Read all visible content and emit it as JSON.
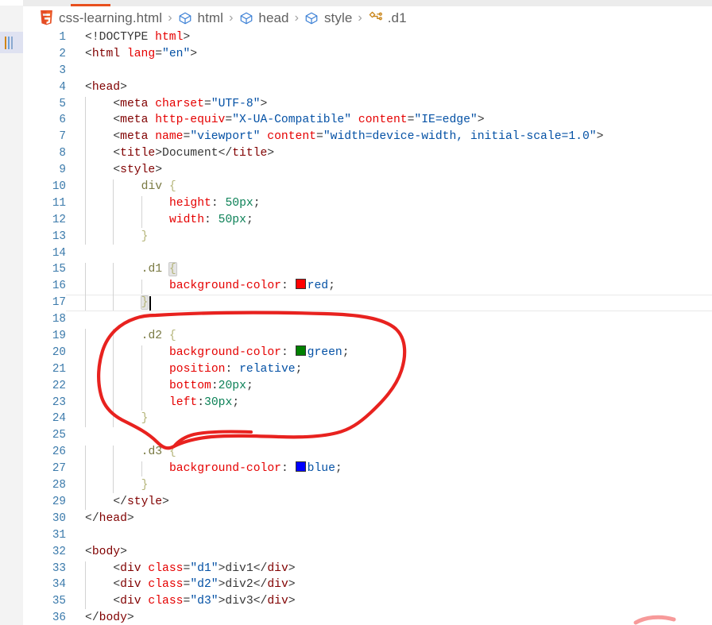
{
  "window": {
    "active_tab_indicator_color": "#e8501e",
    "strip_bg": "#ececec"
  },
  "breadcrumb": {
    "items": [
      {
        "icon": "html5-icon",
        "label": "css-learning.html"
      },
      {
        "icon": "symbol-cube-icon",
        "label": "html"
      },
      {
        "icon": "symbol-cube-icon",
        "label": "head"
      },
      {
        "icon": "symbol-cube-icon",
        "label": "style"
      },
      {
        "icon": "symbol-css-class-icon",
        "label": ".d1"
      }
    ],
    "separator": "›"
  },
  "editor": {
    "language": "html",
    "cursor_line": 17,
    "current_line": 17,
    "lines": [
      {
        "n": "1",
        "indent": 0,
        "tokens": [
          {
            "c": "t-punc",
            "t": "<!DOCTYPE "
          },
          {
            "c": "t-attr",
            "t": "html"
          },
          {
            "c": "t-punc",
            "t": ">"
          }
        ]
      },
      {
        "n": "2",
        "indent": 0,
        "tokens": [
          {
            "c": "t-punc",
            "t": "<"
          },
          {
            "c": "t-tag",
            "t": "html"
          },
          {
            "c": "t-txt",
            "t": " "
          },
          {
            "c": "t-attr",
            "t": "lang"
          },
          {
            "c": "t-punc",
            "t": "="
          },
          {
            "c": "t-str",
            "t": "\"en\""
          },
          {
            "c": "t-punc",
            "t": ">"
          }
        ]
      },
      {
        "n": "3",
        "indent": 0,
        "tokens": []
      },
      {
        "n": "4",
        "indent": 0,
        "tokens": [
          {
            "c": "t-punc",
            "t": "<"
          },
          {
            "c": "t-tag",
            "t": "head"
          },
          {
            "c": "t-punc",
            "t": ">"
          }
        ]
      },
      {
        "n": "5",
        "indent": 1,
        "tokens": [
          {
            "c": "t-punc",
            "t": "<"
          },
          {
            "c": "t-tag",
            "t": "meta"
          },
          {
            "c": "t-txt",
            "t": " "
          },
          {
            "c": "t-attr",
            "t": "charset"
          },
          {
            "c": "t-punc",
            "t": "="
          },
          {
            "c": "t-str",
            "t": "\"UTF-8\""
          },
          {
            "c": "t-punc",
            "t": ">"
          }
        ]
      },
      {
        "n": "6",
        "indent": 1,
        "tokens": [
          {
            "c": "t-punc",
            "t": "<"
          },
          {
            "c": "t-tag",
            "t": "meta"
          },
          {
            "c": "t-txt",
            "t": " "
          },
          {
            "c": "t-attr",
            "t": "http-equiv"
          },
          {
            "c": "t-punc",
            "t": "="
          },
          {
            "c": "t-str",
            "t": "\"X-UA-Compatible\""
          },
          {
            "c": "t-txt",
            "t": " "
          },
          {
            "c": "t-attr",
            "t": "content"
          },
          {
            "c": "t-punc",
            "t": "="
          },
          {
            "c": "t-str",
            "t": "\"IE=edge\""
          },
          {
            "c": "t-punc",
            "t": ">"
          }
        ]
      },
      {
        "n": "7",
        "indent": 1,
        "tokens": [
          {
            "c": "t-punc",
            "t": "<"
          },
          {
            "c": "t-tag",
            "t": "meta"
          },
          {
            "c": "t-txt",
            "t": " "
          },
          {
            "c": "t-attr",
            "t": "name"
          },
          {
            "c": "t-punc",
            "t": "="
          },
          {
            "c": "t-str",
            "t": "\"viewport\""
          },
          {
            "c": "t-txt",
            "t": " "
          },
          {
            "c": "t-attr",
            "t": "content"
          },
          {
            "c": "t-punc",
            "t": "="
          },
          {
            "c": "t-str",
            "t": "\"width=device-width, initial-scale=1.0\""
          },
          {
            "c": "t-punc",
            "t": ">"
          }
        ]
      },
      {
        "n": "8",
        "indent": 1,
        "tokens": [
          {
            "c": "t-punc",
            "t": "<"
          },
          {
            "c": "t-tag",
            "t": "title"
          },
          {
            "c": "t-punc",
            "t": ">"
          },
          {
            "c": "t-txt",
            "t": "Document"
          },
          {
            "c": "t-punc",
            "t": "</"
          },
          {
            "c": "t-tag",
            "t": "title"
          },
          {
            "c": "t-punc",
            "t": ">"
          }
        ]
      },
      {
        "n": "9",
        "indent": 1,
        "tokens": [
          {
            "c": "t-punc",
            "t": "<"
          },
          {
            "c": "t-tag",
            "t": "style"
          },
          {
            "c": "t-punc",
            "t": ">"
          }
        ]
      },
      {
        "n": "10",
        "indent": 2,
        "tokens": [
          {
            "c": "t-sel",
            "t": "div"
          },
          {
            "c": "t-txt",
            "t": " "
          },
          {
            "c": "t-brace",
            "t": "{"
          }
        ]
      },
      {
        "n": "11",
        "indent": 3,
        "tokens": [
          {
            "c": "t-prop",
            "t": "height"
          },
          {
            "c": "t-semi",
            "t": ": "
          },
          {
            "c": "t-num",
            "t": "50px"
          },
          {
            "c": "t-semi",
            "t": ";"
          }
        ]
      },
      {
        "n": "12",
        "indent": 3,
        "tokens": [
          {
            "c": "t-prop",
            "t": "width"
          },
          {
            "c": "t-semi",
            "t": ": "
          },
          {
            "c": "t-num",
            "t": "50px"
          },
          {
            "c": "t-semi",
            "t": ";"
          }
        ]
      },
      {
        "n": "13",
        "indent": 2,
        "tokens": [
          {
            "c": "t-brace",
            "t": "}"
          }
        ]
      },
      {
        "n": "14",
        "indent": 0,
        "tokens": []
      },
      {
        "n": "15",
        "indent": 2,
        "tokens": [
          {
            "c": "t-sel",
            "t": ".d1"
          },
          {
            "c": "t-txt",
            "t": " "
          },
          {
            "c": "t-brace brace-match",
            "t": "{"
          }
        ]
      },
      {
        "n": "16",
        "indent": 3,
        "tokens": [
          {
            "c": "t-prop",
            "t": "background-color"
          },
          {
            "c": "t-semi",
            "t": ": "
          },
          {
            "c": "swatch",
            "t": "",
            "swatch": "#ff0000"
          },
          {
            "c": "t-val",
            "t": "red"
          },
          {
            "c": "t-semi",
            "t": ";"
          }
        ]
      },
      {
        "n": "17",
        "indent": 2,
        "tokens": [
          {
            "c": "t-brace brace-match",
            "t": "}"
          }
        ]
      },
      {
        "n": "18",
        "indent": 0,
        "tokens": []
      },
      {
        "n": "19",
        "indent": 2,
        "tokens": [
          {
            "c": "t-sel",
            "t": ".d2"
          },
          {
            "c": "t-txt",
            "t": " "
          },
          {
            "c": "t-brace",
            "t": "{"
          }
        ]
      },
      {
        "n": "20",
        "indent": 3,
        "tokens": [
          {
            "c": "t-prop",
            "t": "background-color"
          },
          {
            "c": "t-semi",
            "t": ": "
          },
          {
            "c": "swatch",
            "t": "",
            "swatch": "#008000"
          },
          {
            "c": "t-val",
            "t": "green"
          },
          {
            "c": "t-semi",
            "t": ";"
          }
        ]
      },
      {
        "n": "21",
        "indent": 3,
        "tokens": [
          {
            "c": "t-prop",
            "t": "position"
          },
          {
            "c": "t-semi",
            "t": ": "
          },
          {
            "c": "t-val",
            "t": "relative"
          },
          {
            "c": "t-semi",
            "t": ";"
          }
        ]
      },
      {
        "n": "22",
        "indent": 3,
        "tokens": [
          {
            "c": "t-prop",
            "t": "bottom"
          },
          {
            "c": "t-semi",
            "t": ":"
          },
          {
            "c": "t-num",
            "t": "20px"
          },
          {
            "c": "t-semi",
            "t": ";"
          }
        ]
      },
      {
        "n": "23",
        "indent": 3,
        "tokens": [
          {
            "c": "t-prop",
            "t": "left"
          },
          {
            "c": "t-semi",
            "t": ":"
          },
          {
            "c": "t-num",
            "t": "30px"
          },
          {
            "c": "t-semi",
            "t": ";"
          }
        ]
      },
      {
        "n": "24",
        "indent": 2,
        "tokens": [
          {
            "c": "t-brace",
            "t": "}"
          }
        ]
      },
      {
        "n": "25",
        "indent": 0,
        "tokens": []
      },
      {
        "n": "26",
        "indent": 2,
        "tokens": [
          {
            "c": "t-sel",
            "t": ".d3"
          },
          {
            "c": "t-txt",
            "t": " "
          },
          {
            "c": "t-brace",
            "t": "{"
          }
        ]
      },
      {
        "n": "27",
        "indent": 3,
        "tokens": [
          {
            "c": "t-prop",
            "t": "background-color"
          },
          {
            "c": "t-semi",
            "t": ": "
          },
          {
            "c": "swatch",
            "t": "",
            "swatch": "#0000ff"
          },
          {
            "c": "t-val",
            "t": "blue"
          },
          {
            "c": "t-semi",
            "t": ";"
          }
        ]
      },
      {
        "n": "28",
        "indent": 2,
        "tokens": [
          {
            "c": "t-brace",
            "t": "}"
          }
        ]
      },
      {
        "n": "29",
        "indent": 1,
        "tokens": [
          {
            "c": "t-punc",
            "t": "</"
          },
          {
            "c": "t-tag",
            "t": "style"
          },
          {
            "c": "t-punc",
            "t": ">"
          }
        ]
      },
      {
        "n": "30",
        "indent": 0,
        "tokens": [
          {
            "c": "t-punc",
            "t": "</"
          },
          {
            "c": "t-tag",
            "t": "head"
          },
          {
            "c": "t-punc",
            "t": ">"
          }
        ]
      },
      {
        "n": "31",
        "indent": 0,
        "tokens": []
      },
      {
        "n": "32",
        "indent": 0,
        "tokens": [
          {
            "c": "t-punc",
            "t": "<"
          },
          {
            "c": "t-tag",
            "t": "body"
          },
          {
            "c": "t-punc",
            "t": ">"
          }
        ]
      },
      {
        "n": "33",
        "indent": 1,
        "tokens": [
          {
            "c": "t-punc",
            "t": "<"
          },
          {
            "c": "t-tag",
            "t": "div"
          },
          {
            "c": "t-txt",
            "t": " "
          },
          {
            "c": "t-attr",
            "t": "class"
          },
          {
            "c": "t-punc",
            "t": "="
          },
          {
            "c": "t-str",
            "t": "\"d1\""
          },
          {
            "c": "t-punc",
            "t": ">"
          },
          {
            "c": "t-txt",
            "t": "div1"
          },
          {
            "c": "t-punc",
            "t": "</"
          },
          {
            "c": "t-tag",
            "t": "div"
          },
          {
            "c": "t-punc",
            "t": ">"
          }
        ]
      },
      {
        "n": "34",
        "indent": 1,
        "tokens": [
          {
            "c": "t-punc",
            "t": "<"
          },
          {
            "c": "t-tag",
            "t": "div"
          },
          {
            "c": "t-txt",
            "t": " "
          },
          {
            "c": "t-attr",
            "t": "class"
          },
          {
            "c": "t-punc",
            "t": "="
          },
          {
            "c": "t-str",
            "t": "\"d2\""
          },
          {
            "c": "t-punc",
            "t": ">"
          },
          {
            "c": "t-txt",
            "t": "div2"
          },
          {
            "c": "t-punc",
            "t": "</"
          },
          {
            "c": "t-tag",
            "t": "div"
          },
          {
            "c": "t-punc",
            "t": ">"
          }
        ]
      },
      {
        "n": "35",
        "indent": 1,
        "tokens": [
          {
            "c": "t-punc",
            "t": "<"
          },
          {
            "c": "t-tag",
            "t": "div"
          },
          {
            "c": "t-txt",
            "t": " "
          },
          {
            "c": "t-attr",
            "t": "class"
          },
          {
            "c": "t-punc",
            "t": "="
          },
          {
            "c": "t-str",
            "t": "\"d3\""
          },
          {
            "c": "t-punc",
            "t": ">"
          },
          {
            "c": "t-txt",
            "t": "div3"
          },
          {
            "c": "t-punc",
            "t": "</"
          },
          {
            "c": "t-tag",
            "t": "div"
          },
          {
            "c": "t-punc",
            "t": ">"
          }
        ]
      },
      {
        "n": "36",
        "indent": 0,
        "tokens": [
          {
            "c": "t-punc",
            "t": "</"
          },
          {
            "c": "t-tag",
            "t": "body"
          },
          {
            "c": "t-punc",
            "t": ">"
          }
        ]
      }
    ]
  },
  "annotations": {
    "circle_color": "#e8221f",
    "circle_label": "hand-drawn-ellipse-around-d2-rule",
    "secondary_arc_color": "#f79a9a"
  }
}
